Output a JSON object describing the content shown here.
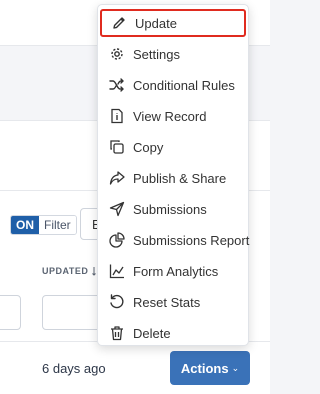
{
  "filters": {
    "toggle_on_label": "ON",
    "toggle_filter_label": "Filter",
    "filter_box_text": "E"
  },
  "table": {
    "updated_column_label": "UPDATED",
    "row_updated_value": "6 days ago"
  },
  "actions_button": {
    "label": "Actions",
    "caret": "⌄"
  },
  "menu": {
    "items": [
      {
        "label": "Update",
        "icon": "pencil-icon",
        "selected": true
      },
      {
        "label": "Settings",
        "icon": "gear-icon"
      },
      {
        "label": "Conditional Rules",
        "icon": "shuffle-icon"
      },
      {
        "label": "View Record",
        "icon": "document-icon"
      },
      {
        "label": "Copy",
        "icon": "copy-icon"
      },
      {
        "label": "Publish & Share",
        "icon": "share-icon"
      },
      {
        "label": "Submissions",
        "icon": "paper-plane-icon"
      },
      {
        "label": "Submissions Report",
        "icon": "pie-chart-icon"
      },
      {
        "label": "Form Analytics",
        "icon": "bar-chart-icon"
      },
      {
        "label": "Reset Stats",
        "icon": "reset-icon"
      },
      {
        "label": "Delete",
        "icon": "trash-icon"
      }
    ]
  },
  "colors": {
    "accent_blue": "#1f5fa8",
    "actions_blue": "#3a72b8",
    "highlight_red": "#e02b1f"
  }
}
